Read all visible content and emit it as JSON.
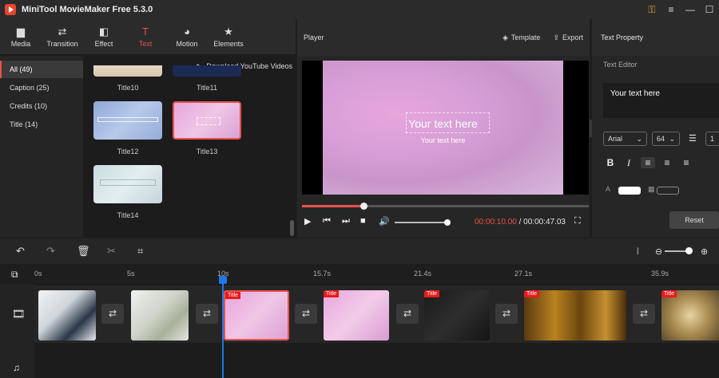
{
  "app": {
    "title": "MiniTool MovieMaker Free 5.3.0",
    "colors": {
      "accent": "#e8524a",
      "playhead": "#1f78e8",
      "tag": "#e81b1b"
    }
  },
  "toolbar": [
    {
      "label": "Media",
      "icon": "folder-icon",
      "glyph": "▆"
    },
    {
      "label": "Transition",
      "icon": "transition-icon",
      "glyph": "⇄"
    },
    {
      "label": "Effect",
      "icon": "effect-icon",
      "glyph": "◧"
    },
    {
      "label": "Text",
      "icon": "text-icon",
      "glyph": "T"
    },
    {
      "label": "Motion",
      "icon": "motion-icon",
      "glyph": "◕"
    },
    {
      "label": "Elements",
      "icon": "elements-icon",
      "glyph": "★"
    }
  ],
  "categories": [
    {
      "label": "All (49)"
    },
    {
      "label": "Caption (25)"
    },
    {
      "label": "Credits (10)"
    },
    {
      "label": "Title (14)"
    }
  ],
  "library": {
    "download": "Download YouTube Videos",
    "thumbs": [
      {
        "label": "Title10"
      },
      {
        "label": "Title11"
      },
      {
        "label": "Title12"
      },
      {
        "label": "Title13"
      },
      {
        "label": "Title14"
      }
    ]
  },
  "player": {
    "title": "Player",
    "template": "Template",
    "export": "Export",
    "text_main": "Your text here",
    "text_sub": "Your text here",
    "time_current": "00:00:10.00",
    "time_total": "/ 00:00:47.03",
    "progress": 0.22,
    "volume": 0.9
  },
  "property": {
    "title": "Text Property",
    "subtitle": "Text Editor",
    "text": "Your text here",
    "font": "Arial",
    "size": "64",
    "line": "1",
    "reset": "Reset"
  },
  "timeline": {
    "ticks": [
      "0s",
      "5s",
      "10s",
      "15.7s",
      "21.4s",
      "27.1s",
      "35.9s"
    ],
    "tag": "Title",
    "zoom": 0.8
  }
}
